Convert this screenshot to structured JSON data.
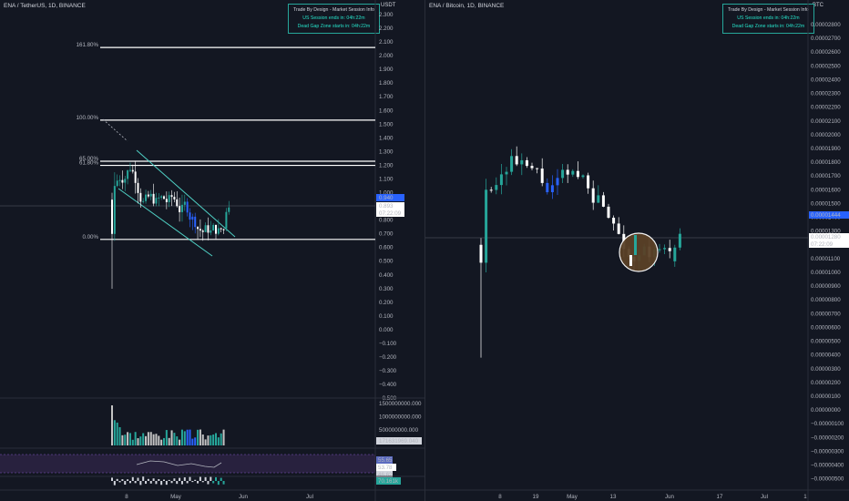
{
  "left": {
    "symbol": "ENA / TetherUS, 1D, BINANCE",
    "currency": "USDT",
    "infobox": {
      "title": "Trade By Design - Market Session Info",
      "line1": "US Session ends in: 04h:22m",
      "line2": "Dead Gap Zone starts in: 04h:22m"
    },
    "y_ticks": [
      "2.300",
      "2.200",
      "2.100",
      "2.000",
      "1.900",
      "1.800",
      "1.700",
      "1.600",
      "1.500",
      "1.400",
      "1.300",
      "1.200",
      "1.100",
      "1.000",
      "0.900",
      "0.800",
      "0.700",
      "0.600",
      "0.500",
      "0.400",
      "0.300",
      "0.200",
      "0.100",
      "0.000",
      "−0.100",
      "−0.200",
      "−0.300",
      "−0.400",
      "−0.500"
    ],
    "fib_levels": [
      {
        "label": "161.80%",
        "value": 2.06
      },
      {
        "label": "100.00%",
        "value": 1.53
      },
      {
        "label": "65.00%",
        "value": 1.23
      },
      {
        "label": "61.80%",
        "value": 1.2
      },
      {
        "label": "0.00%",
        "value": 0.66
      }
    ],
    "price_tags": {
      "high": "0.940",
      "last": "0.893",
      "countdown": "07:22:09"
    },
    "volume_ticks": [
      "1500000000.000",
      "1000000000.000",
      "500000000.000"
    ],
    "volume_tag": "171631969.040",
    "rsi_tags": {
      "upper": "55.65",
      "value": "53.78",
      "lower": "46.62"
    },
    "osc_tag": "70.161k",
    "x_ticks": [
      "8",
      "May",
      "Jun",
      "Jul"
    ]
  },
  "right": {
    "symbol": "ENA / Bitcoin, 1D, BINANCE",
    "currency": "BTC",
    "infobox": {
      "title": "Trade By Design - Market Session Info",
      "line1": "US Session ends in: 04h:22m",
      "line2": "Dead Gap Zone starts in: 04h:22m"
    },
    "y_ticks": [
      "0.00002800",
      "0.00002700",
      "0.00002600",
      "0.00002500",
      "0.00002400",
      "0.00002300",
      "0.00002200",
      "0.00002100",
      "0.00002000",
      "0.00001900",
      "0.00001800",
      "0.00001700",
      "0.00001600",
      "0.00001500",
      "0.00001400",
      "0.00001300",
      "0.00001200",
      "0.00001100",
      "0.00001000",
      "0.00000900",
      "0.00000800",
      "0.00000700",
      "0.00000600",
      "0.00000500",
      "0.00000400",
      "0.00000300",
      "0.00000200",
      "0.00000100",
      "0.00000000",
      "−0.00000100",
      "−0.00000200",
      "−0.00000300",
      "−0.00000400",
      "−0.00000500"
    ],
    "price_tags": {
      "high": "0.00001444",
      "last": "0.00001280",
      "countdown": "07:22:09"
    },
    "x_ticks": [
      "8",
      "19",
      "May",
      "13",
      "Jun",
      "17",
      "Jul",
      "1"
    ]
  },
  "colors": {
    "bg": "#131722",
    "up": "#26a69a",
    "down": "#ffffff",
    "blue": "#2962ff",
    "fib": "#ffffff",
    "channel": "#4fd1c5",
    "circle_fill": "#5a4127"
  }
}
